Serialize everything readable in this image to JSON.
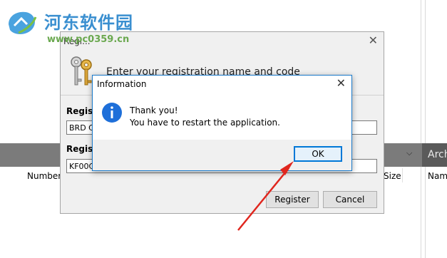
{
  "watermark": {
    "title": "河东软件园",
    "url": "www.pc0359.cn"
  },
  "background_app": {
    "columns": [
      "Number",
      "Size",
      "Nam"
    ],
    "archive_header": "Arch"
  },
  "registration_dialog": {
    "title": "Regi...",
    "instruction": "Enter your registration name and code",
    "name_label": "Registr",
    "name_value": "BRD C",
    "code_label": "Registr",
    "code_value": "KF00C",
    "register_button": "Register",
    "cancel_button": "Cancel"
  },
  "info_dialog": {
    "title": "Information",
    "message_line1": "Thank you!",
    "message_line2": "You have to restart the application.",
    "ok_button": "OK"
  },
  "colors": {
    "accent": "#0078d7",
    "arrow": "#e0261e",
    "watermark_title": "#3a8fd0",
    "watermark_url": "#6aa84f"
  }
}
